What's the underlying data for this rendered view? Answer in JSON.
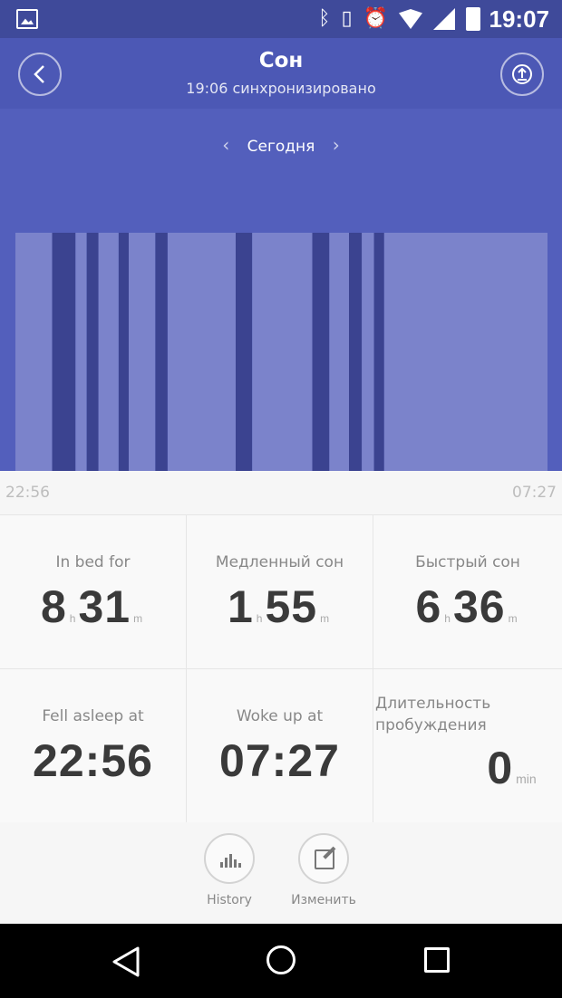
{
  "status_bar": {
    "time": "19:07",
    "icons": [
      "gallery-icon",
      "bluetooth-icon",
      "vibrate-icon",
      "alarm-icon",
      "wifi-icon",
      "cell-signal-icon",
      "battery-icon"
    ]
  },
  "header": {
    "title": "Сон",
    "subtitle": "19:06 синхронизировано",
    "back_icon": "chevron-left-icon",
    "share_icon": "upload-icon"
  },
  "date_nav": {
    "label": "Сегодня",
    "prev": "‹",
    "next": "›"
  },
  "chart_data": {
    "type": "bar",
    "x_start": "22:56",
    "x_end": "07:27",
    "segment_types": [
      "light",
      "deep"
    ],
    "segments": [
      {
        "type": "light",
        "start": 0.0,
        "end": 0.069
      },
      {
        "type": "deep",
        "start": 0.069,
        "end": 0.113
      },
      {
        "type": "light",
        "start": 0.113,
        "end": 0.134
      },
      {
        "type": "deep",
        "start": 0.134,
        "end": 0.156
      },
      {
        "type": "light",
        "start": 0.156,
        "end": 0.194
      },
      {
        "type": "deep",
        "start": 0.194,
        "end": 0.213
      },
      {
        "type": "light",
        "start": 0.213,
        "end": 0.263
      },
      {
        "type": "deep",
        "start": 0.263,
        "end": 0.286
      },
      {
        "type": "light",
        "start": 0.286,
        "end": 0.414
      },
      {
        "type": "deep",
        "start": 0.414,
        "end": 0.445
      },
      {
        "type": "light",
        "start": 0.445,
        "end": 0.558
      },
      {
        "type": "deep",
        "start": 0.558,
        "end": 0.59
      },
      {
        "type": "light",
        "start": 0.59,
        "end": 0.627
      },
      {
        "type": "deep",
        "start": 0.627,
        "end": 0.651
      },
      {
        "type": "light",
        "start": 0.651,
        "end": 0.674
      },
      {
        "type": "deep",
        "start": 0.674,
        "end": 0.693
      },
      {
        "type": "light",
        "start": 0.693,
        "end": 1.0
      }
    ],
    "colors": {
      "light": "#7b83cb",
      "deep": "#3b4390",
      "background": "#535fbc"
    }
  },
  "time_axis": {
    "start": "22:56",
    "end": "07:27"
  },
  "stats": {
    "in_bed": {
      "label": "In bed for",
      "hours": "8",
      "h_unit": "h",
      "minutes": "31",
      "m_unit": "m"
    },
    "deep_sleep": {
      "label": "Медленный сон",
      "hours": "1",
      "h_unit": "h",
      "minutes": "55",
      "m_unit": "m"
    },
    "light_sleep": {
      "label": "Быстрый сон",
      "hours": "6",
      "h_unit": "h",
      "minutes": "36",
      "m_unit": "m"
    },
    "fell_asleep": {
      "label": "Fell asleep at",
      "value": "22:56"
    },
    "woke_up": {
      "label": "Woke up at",
      "value": "07:27"
    },
    "awake": {
      "label": "Длительность пробуждения",
      "value": "0",
      "unit": "min"
    }
  },
  "actions": {
    "history": {
      "label": "History",
      "icon": "bar-chart-icon"
    },
    "edit": {
      "label": "Изменить",
      "icon": "edit-icon"
    }
  },
  "navbar": {
    "back_icon": "back-triangle-icon",
    "home_icon": "home-circle-icon",
    "recent_icon": "recent-square-icon"
  }
}
